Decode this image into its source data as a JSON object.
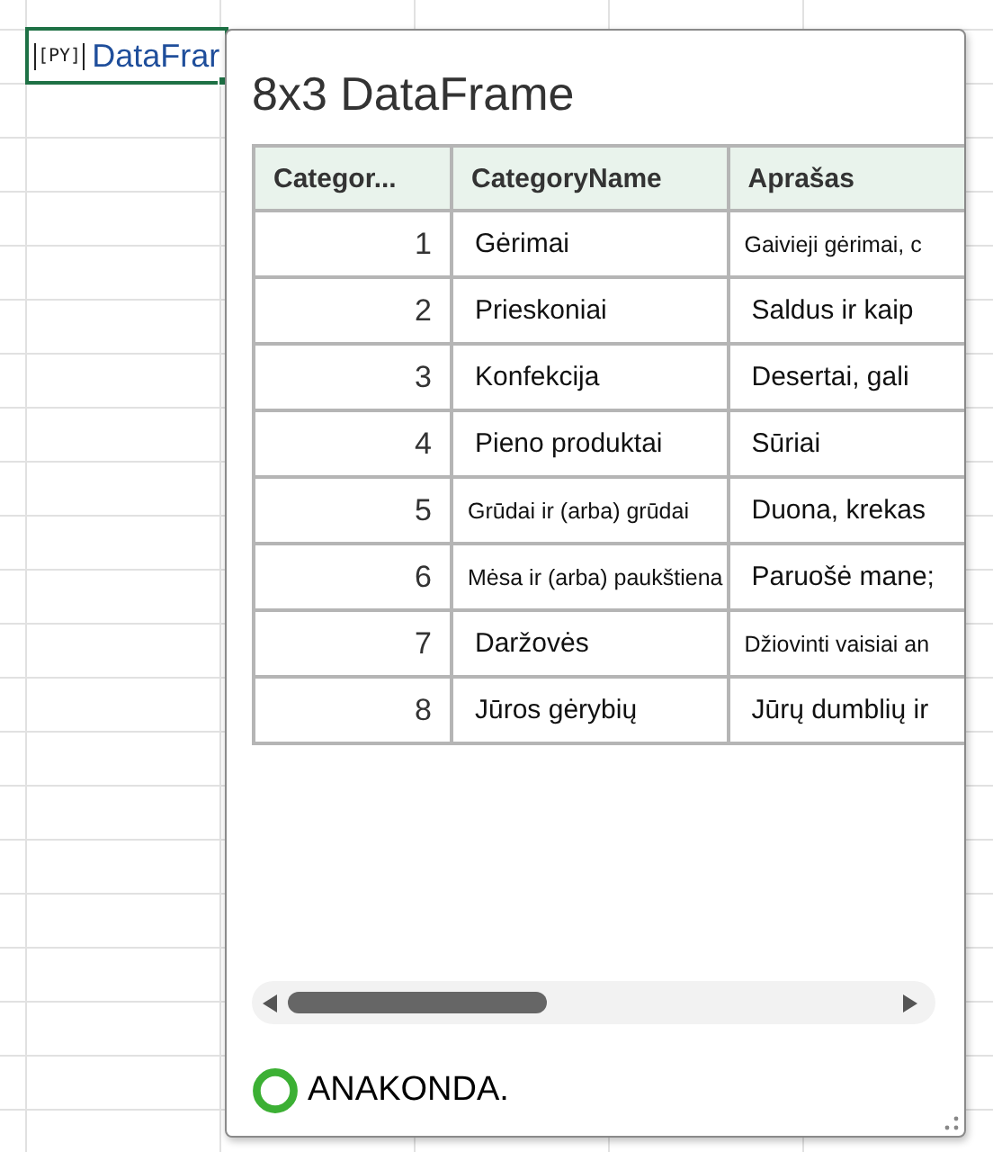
{
  "cell": {
    "badge": "[PY]",
    "value": "DataFrar"
  },
  "card": {
    "title": "8x3 DataFrame",
    "table": {
      "columns": [
        "Categor...",
        "CategoryName",
        "Aprašas"
      ],
      "rows": [
        {
          "id": "1",
          "name": "Gėrimai",
          "description": "Gaivieji gėrimai, c",
          "name_small": false,
          "description_small": true
        },
        {
          "id": "2",
          "name": "Prieskoniai",
          "description": "Saldus ir kaip",
          "name_small": false,
          "description_small": false
        },
        {
          "id": "3",
          "name": "Konfekcija",
          "description": "Desertai, gali",
          "name_small": false,
          "description_small": false
        },
        {
          "id": "4",
          "name": "Pieno produktai",
          "description": "Sūriai",
          "name_small": false,
          "description_small": false
        },
        {
          "id": "5",
          "name": "Grūdai ir (arba) grūdai",
          "description": "Duona, krekas",
          "name_small": true,
          "description_small": false
        },
        {
          "id": "6",
          "name": "Mėsa ir (arba) paukštiena",
          "description": "Paruošė mane;",
          "name_small": true,
          "description_small": false
        },
        {
          "id": "7",
          "name": "Daržovės",
          "description": "Džiovinti vaisiai an",
          "name_small": false,
          "description_small": true
        },
        {
          "id": "8",
          "name": "Jūros gėrybių",
          "description": "Jūrų dumblių ir",
          "name_small": false,
          "description_small": false
        }
      ]
    },
    "footer": {
      "label": "ANAKONDA."
    }
  }
}
